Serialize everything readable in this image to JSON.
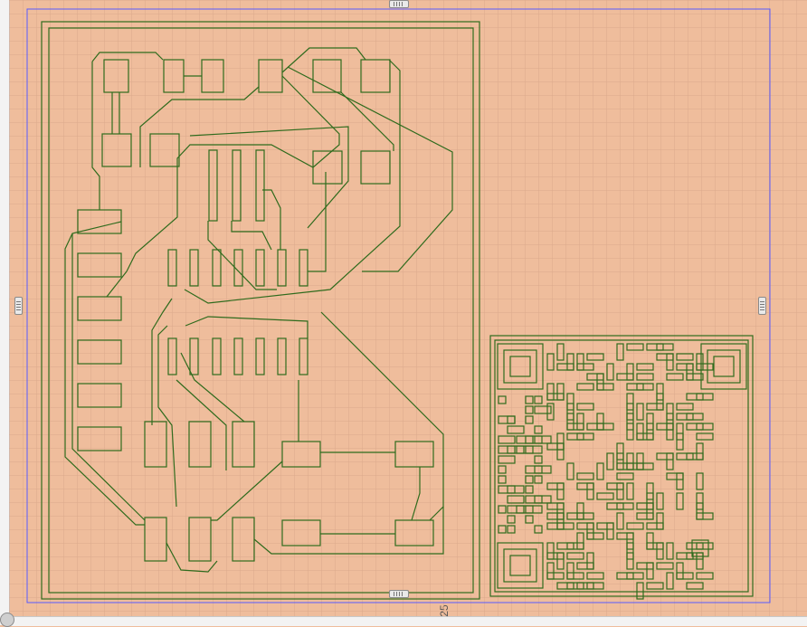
{
  "ruler": {
    "bottom_label": "25"
  },
  "colors": {
    "background": "#efbd9c",
    "grid": "#d9a98b",
    "trace": "#2f6b1d",
    "selection": "#5a5aff"
  },
  "icons": {
    "grip": "drag-handle-icon",
    "corner": "resize-corner-icon"
  }
}
